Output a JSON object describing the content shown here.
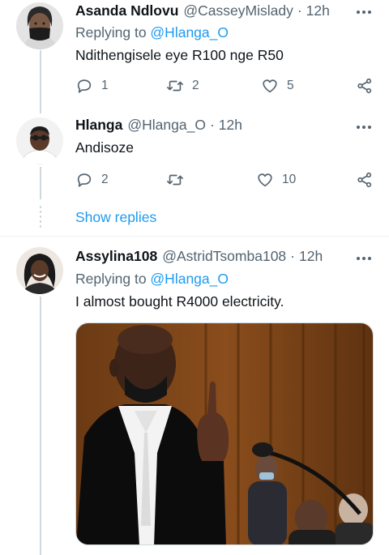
{
  "tweets": [
    {
      "name": "Asanda Ndlovu",
      "handle": "@CasseyMislady",
      "dot": "·",
      "time": "12h",
      "replying_prefix": "Replying to ",
      "replying_to": "@Hlanga_O",
      "text": "Ndithengisele eye R100 nge R50",
      "reply_count": "1",
      "retweet_count": "2",
      "like_count": "5"
    },
    {
      "name": "Hlanga",
      "handle": "@Hlanga_O",
      "dot": "·",
      "time": "12h",
      "text": "Andisoze",
      "reply_count": "2",
      "retweet_count": "",
      "like_count": "10"
    },
    {
      "name": "Assylina108",
      "handle": "@AstridTsomba108",
      "dot": "·",
      "time": "12h",
      "replying_prefix": "Replying to ",
      "replying_to": "@Hlanga_O",
      "text": "I almost bought R4000 electricity."
    }
  ],
  "show_replies": "Show replies",
  "icons": {
    "reply": "reply-icon",
    "retweet": "retweet-icon",
    "like": "like-icon",
    "share": "share-icon",
    "more": "more-icon"
  },
  "colors": {
    "link": "#1d9bf0",
    "secondary_text": "#536471",
    "primary_text": "#0f1419",
    "thread_line": "#cfd9de"
  }
}
